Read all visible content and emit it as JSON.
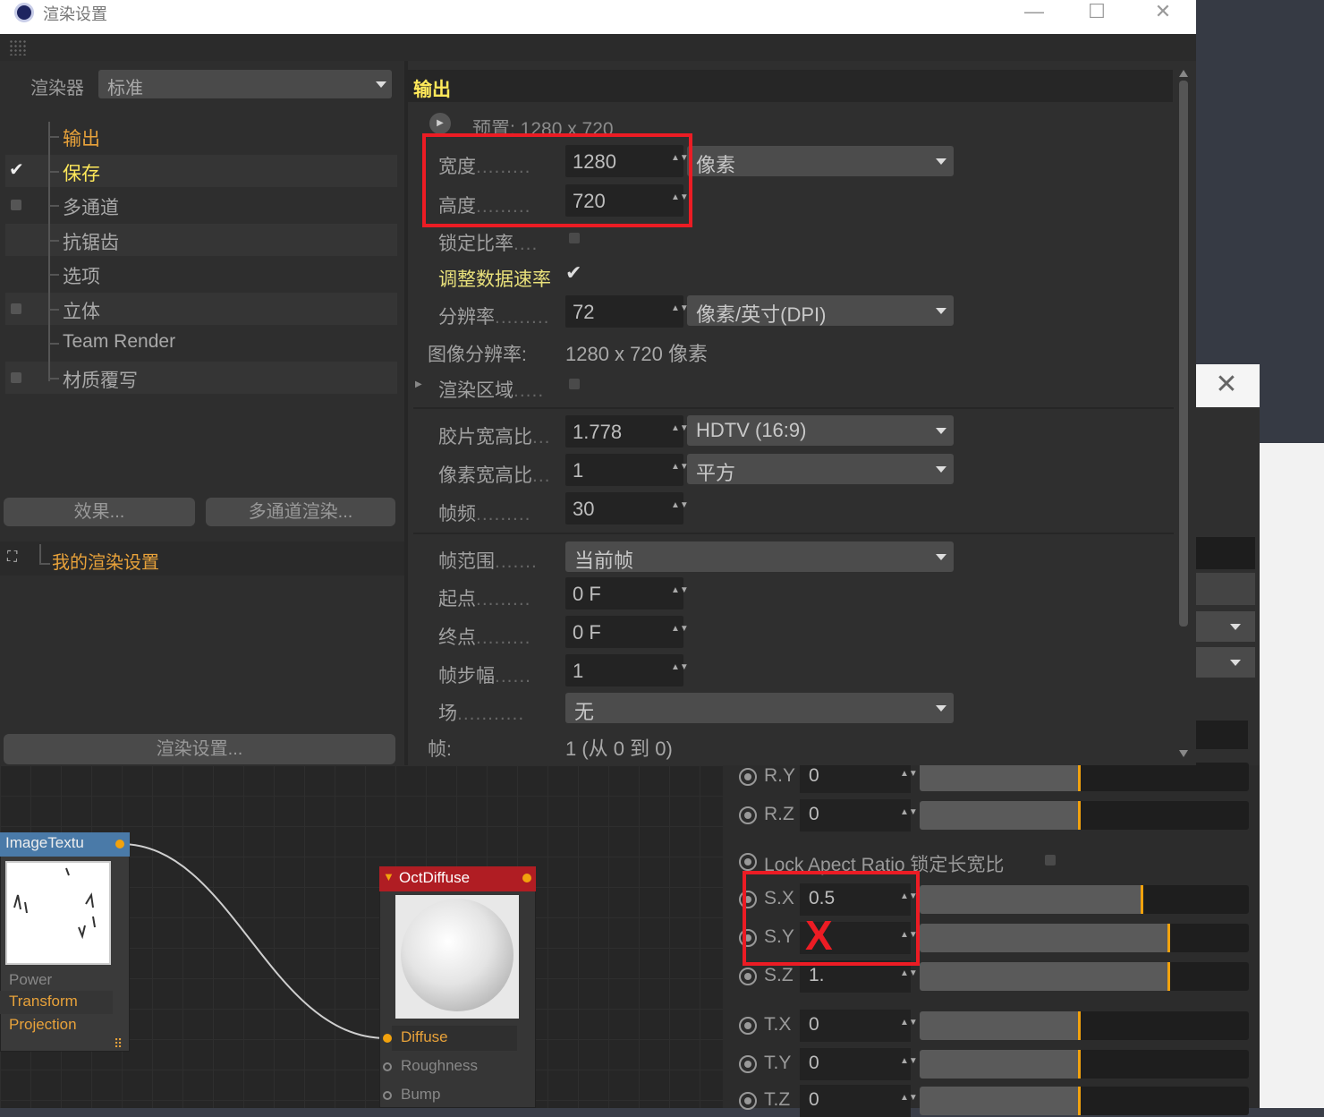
{
  "window": {
    "title": "渲染设置",
    "minimize": "—",
    "maximize": "☐",
    "close": "✕"
  },
  "popup": {
    "close": "✕"
  },
  "left": {
    "renderer_label": "渲染器",
    "renderer_value": "标准",
    "tree": [
      {
        "label": "输出",
        "style": "orange",
        "check": ""
      },
      {
        "label": "保存",
        "style": "yellow",
        "check": "✔"
      },
      {
        "label": "多通道",
        "style": "normal",
        "check": "box"
      },
      {
        "label": "抗锯齿",
        "style": "normal",
        "check": ""
      },
      {
        "label": "选项",
        "style": "normal",
        "check": ""
      },
      {
        "label": "立体",
        "style": "normal",
        "check": "box"
      },
      {
        "label": "Team Render",
        "style": "normal",
        "check": ""
      },
      {
        "label": "材质覆写",
        "style": "normal",
        "check": "box"
      }
    ],
    "effects_button": "效果...",
    "multipass_button": "多通道渲染...",
    "preset_label": "我的渲染设置",
    "render_settings_button": "渲染设置..."
  },
  "right": {
    "section_title": "输出",
    "preset_text": "预置: 1280 x 720",
    "width_label": "宽度",
    "width_value": "1280",
    "unit_value": "像素",
    "height_label": "高度",
    "height_value": "720",
    "lock_ratio_label": "锁定比率",
    "adjust_rate_label": "调整数据速率",
    "adjust_rate_check": "✔",
    "resolution_label": "分辨率",
    "resolution_value": "72",
    "resolution_unit": "像素/英寸(DPI)",
    "image_res_label": "图像分辨率:",
    "image_res_value": "1280 x 720 像素",
    "render_region_label": "渲染区域",
    "film_aspect_label": "胶片宽高比",
    "film_aspect_value": "1.778",
    "film_aspect_preset": "HDTV (16:9)",
    "pixel_aspect_label": "像素宽高比",
    "pixel_aspect_value": "1",
    "pixel_aspect_preset": "平方",
    "fps_label": "帧频",
    "fps_value": "30",
    "frame_range_label": "帧范围",
    "frame_range_value": "当前帧",
    "start_label": "起点",
    "start_value": "0 F",
    "end_label": "终点",
    "end_value": "0 F",
    "frame_step_label": "帧步幅",
    "frame_step_value": "1",
    "field_label": "场",
    "field_value": "无",
    "frames_label": "帧:",
    "frames_value": "1 (从 0 到 0)"
  },
  "nodes": {
    "image": {
      "title": "ImageTextu",
      "ports": [
        "Power",
        "Transform",
        "Projection"
      ]
    },
    "diffuse": {
      "title": "OctDiffuse",
      "ports": [
        "Diffuse",
        "Roughness",
        "Bump"
      ]
    }
  },
  "attributes": {
    "lock_label": "Lock Apect Ratio 锁定长宽比",
    "rows": [
      {
        "label": "R.Y",
        "value": "0",
        "fill": 0.49
      },
      {
        "label": "R.Z",
        "value": "0",
        "fill": 0.49
      },
      {
        "label": "S.X",
        "value": "0.5",
        "fill": 0.68
      },
      {
        "label": "S.Y",
        "value": "",
        "fill": 0.76
      },
      {
        "label": "S.Z",
        "value": "1.",
        "fill": 0.76
      },
      {
        "label": "T.X",
        "value": "0",
        "fill": 0.49
      },
      {
        "label": "T.Y",
        "value": "0",
        "fill": 0.49
      },
      {
        "label": "T.Z",
        "value": "0",
        "fill": 0.49
      }
    ],
    "annotation_x": "X"
  },
  "colors": {
    "highlight_red": "#ec1c24",
    "accent_orange": "#e8a23a",
    "accent_yellow": "#ffe95a",
    "node_port": "#f2a20d"
  }
}
